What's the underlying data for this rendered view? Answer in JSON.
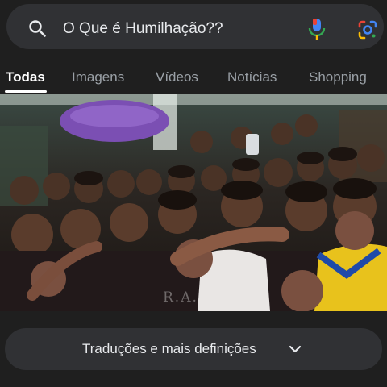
{
  "search": {
    "query": "O Que é Humilhação??",
    "icons": {
      "search": "search-icon",
      "voice": "microphone-icon",
      "lens": "google-lens-icon"
    }
  },
  "tabs": [
    {
      "label": "Todas",
      "active": true
    },
    {
      "label": "Imagens",
      "active": false
    },
    {
      "label": "Vídeos",
      "active": false
    },
    {
      "label": "Notícias",
      "active": false
    },
    {
      "label": "Shopping",
      "active": false
    }
  ],
  "media": {
    "watermark": "R.A."
  },
  "more": {
    "label": "Traduções e mais definições",
    "icon": "chevron-down-icon"
  },
  "colors": {
    "background": "#1f1f1f",
    "surface": "#303134",
    "text": "#e8eaed",
    "muted": "#9aa0a6",
    "mic_blue": "#4285f4",
    "mic_red": "#ea4335",
    "lens_yellow": "#fbbc04",
    "lens_green": "#34a853"
  }
}
